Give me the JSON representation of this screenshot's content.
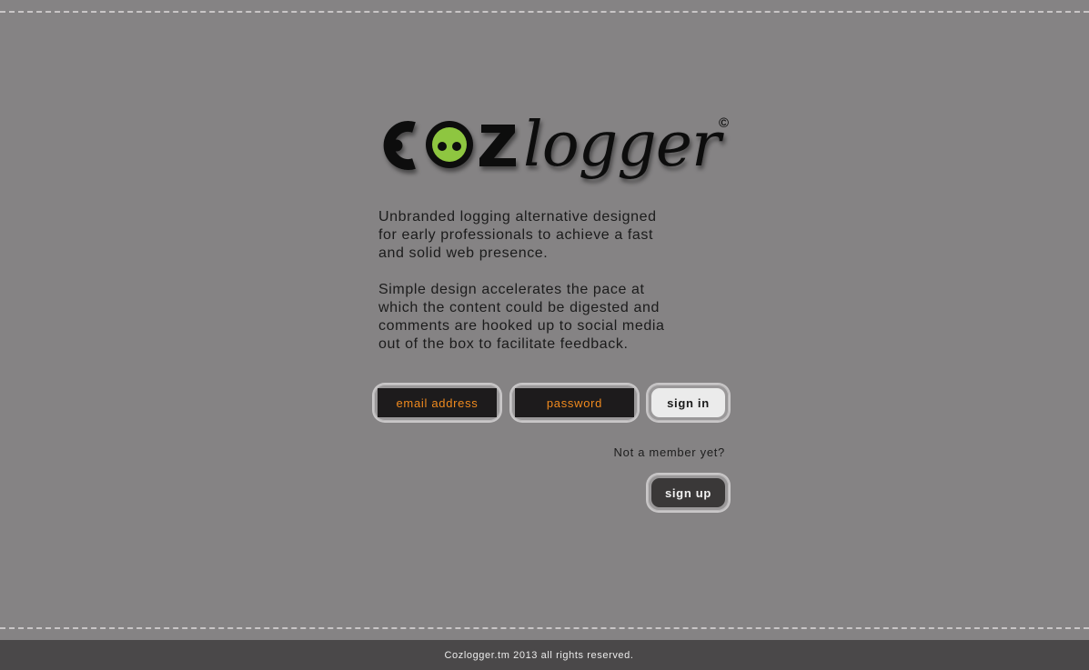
{
  "brand": {
    "logo_prefix": "c",
    "logo_eye_part": "o",
    "logo_z": "z",
    "logo_word": "logger",
    "logo_symbol": "©",
    "logo_full": "cozlogger©",
    "eye_color": "#8ec63f"
  },
  "intro": {
    "paragraph1": "Unbranded logging alternative designed\nfor early professionals to achieve a fast\nand solid web presence.",
    "paragraph2": "Simple design accelerates the pace at\nwhich the content could be digested and\ncomments are hooked up to social media\nout of the box to facilitate feedback."
  },
  "login": {
    "email_placeholder": "email address",
    "password_placeholder": "password",
    "signin_label": "sign in",
    "not_member_text": "Not a member yet?",
    "signup_label": "sign up",
    "accent_color": "#f08a1e"
  },
  "footer": {
    "copyright": "Cozlogger.tm 2013 all rights reserved."
  }
}
